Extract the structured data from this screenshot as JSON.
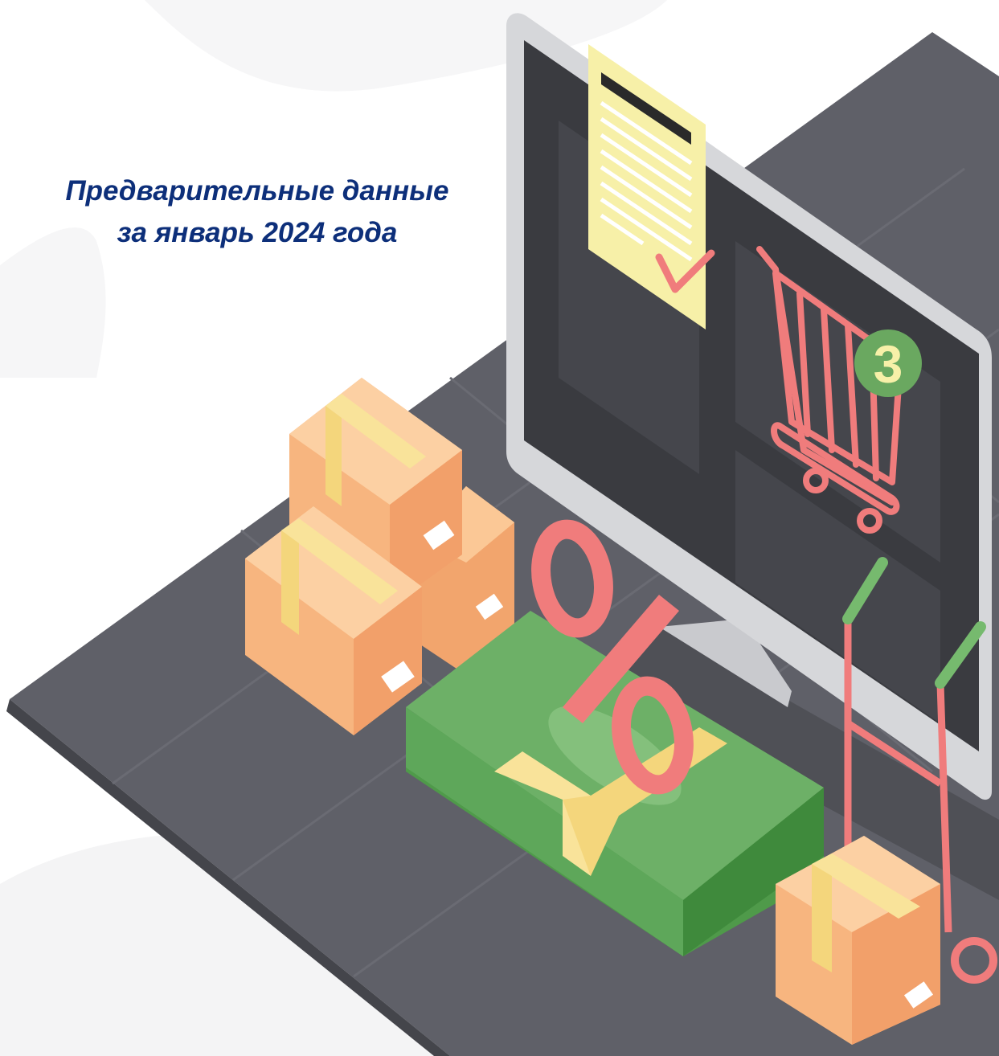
{
  "headline": {
    "line1": "Предварительные данные",
    "line2": "за январь 2024 года"
  },
  "illustration": {
    "cart_badge": "3",
    "percent_sign": "%",
    "icons": [
      "monitor-icon",
      "shopping-cart-icon",
      "receipt-icon",
      "checkmark-icon",
      "percent-icon",
      "banknote-stack-icon",
      "parcel-box-icon",
      "hand-truck-icon"
    ]
  },
  "colors": {
    "headline": "#0d2f7a",
    "desk": "#5f6068",
    "screen": "#3a3b40",
    "box": "#f7b57f",
    "money": "#6db067",
    "accent": "#f07c7c",
    "badge": "#6aa860",
    "receipt": "#f7f0a8"
  }
}
